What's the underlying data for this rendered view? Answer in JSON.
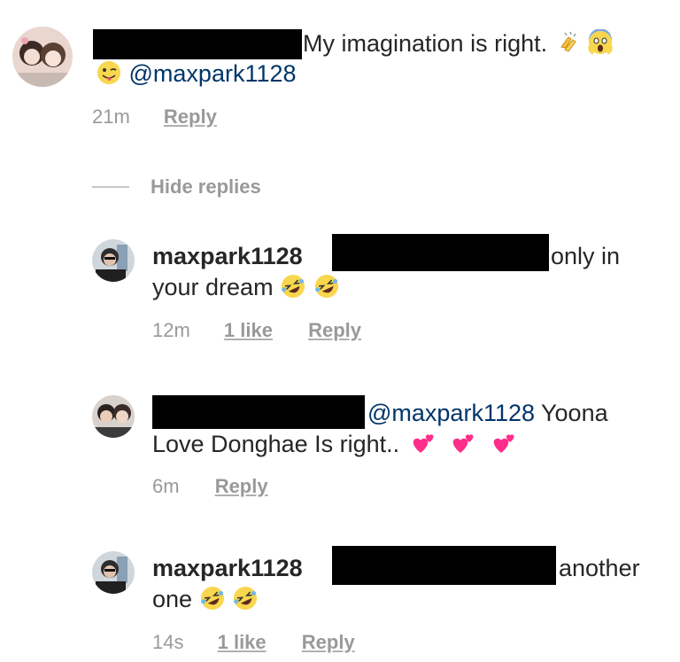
{
  "comments": [
    {
      "text": "My imagination is right.",
      "mention": "@maxpark1128",
      "emojis": [
        "clapping-hands",
        "screaming-face",
        "winking-tongue-face"
      ],
      "time": "21m",
      "reply_label": "Reply"
    }
  ],
  "hide_replies_label": "Hide replies",
  "replies": [
    {
      "username": "maxpark1128",
      "text_1": "only in",
      "text_2": "your dream",
      "emojis": [
        "rofl-face",
        "rofl-face"
      ],
      "time": "12m",
      "likes": "1 like",
      "reply_label": "Reply"
    },
    {
      "mention": "@maxpark1128",
      "text_1": "Yoona",
      "text_2": "Love Donghae Is right..",
      "emojis": [
        "two-hearts",
        "two-hearts",
        "two-hearts"
      ],
      "time": "6m",
      "reply_label": "Reply"
    },
    {
      "username": "maxpark1128",
      "text_1": "another",
      "text_2": "one",
      "emojis": [
        "rofl-face",
        "rofl-face"
      ],
      "time": "14s",
      "likes": "1 like",
      "reply_label": "Reply"
    }
  ],
  "colors": {
    "text": "#262626",
    "meta": "#999999",
    "mention": "#003569",
    "redaction": "#000000"
  }
}
